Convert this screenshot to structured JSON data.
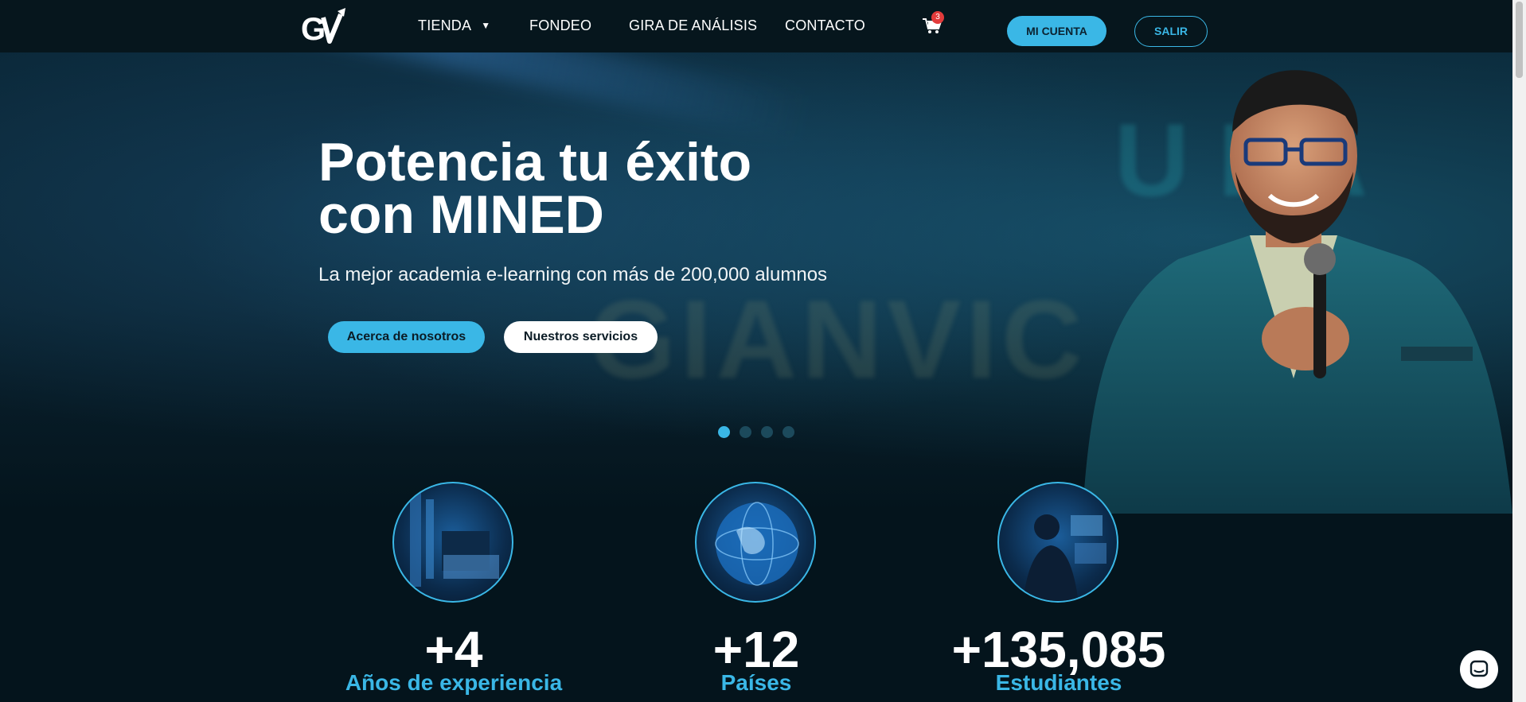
{
  "nav": {
    "logo_alt": "GV",
    "items": [
      {
        "label": "TIENDA",
        "has_dropdown": true
      },
      {
        "label": "FONDEO"
      },
      {
        "label": "GIRA DE ANÁLISIS"
      },
      {
        "label": "CONTACTO"
      }
    ],
    "cart_count": "3",
    "account_label": "MI CUENTA",
    "logout_label": "SALIR"
  },
  "hero": {
    "title_line1": "Potencia tu éxito",
    "title_line2": "con MINED",
    "subtitle": "La mejor academia e-learning con más de 200,000 alumnos",
    "btn_about": "Acerca de nosotros",
    "btn_services": "Nuestros servicios",
    "slides": 4,
    "active_slide": 1
  },
  "stats": [
    {
      "value": "+4",
      "label": "Años de experiencia",
      "icon": "server-room-image"
    },
    {
      "value": "+12",
      "label": "Países",
      "icon": "globe-image"
    },
    {
      "value": "+135,085",
      "label": "Estudiantes",
      "icon": "trader-monitors-image"
    }
  ],
  "colors": {
    "accent": "#3ab7e6",
    "background": "#04141c",
    "nav_background": "#06161d",
    "badge": "#e23b3b"
  }
}
